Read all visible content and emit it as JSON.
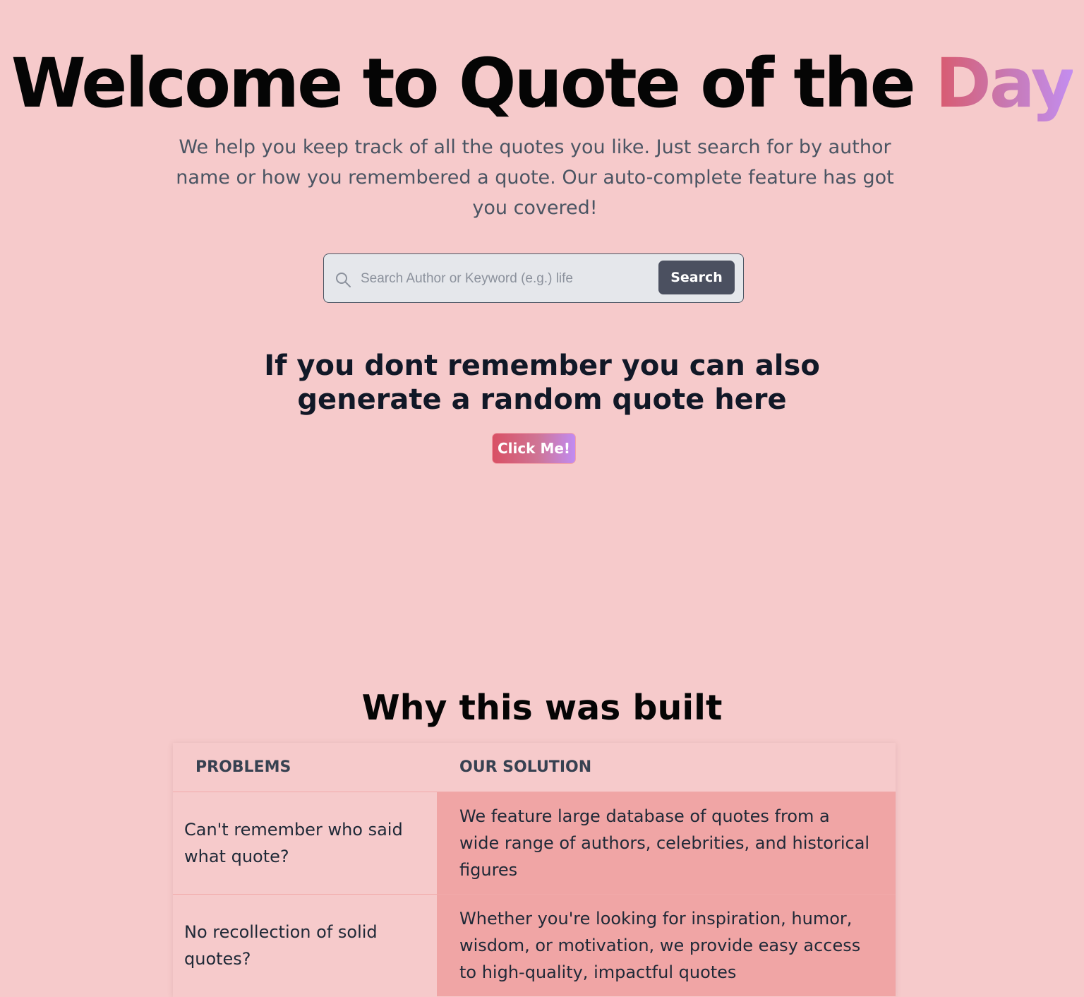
{
  "hero": {
    "title_main": "Welcome to Quote of the",
    "title_accent": "Day",
    "description": "We help you keep track of all the quotes you like. Just search for by author name or how you remembered a quote. Our auto-complete feature has got you covered!"
  },
  "search": {
    "icon": "search-icon",
    "placeholder": "Search Author or Keyword (e.g.) life",
    "value": "",
    "button_label": "Search"
  },
  "random": {
    "heading": "If you dont remember you can also generate a random quote here",
    "button_label": "Click Me!"
  },
  "why": {
    "title": "Why this was built",
    "headers": {
      "problems": "PROBLEMS",
      "solution": "OUR SOLUTION"
    },
    "rows": [
      {
        "problem": "Can't remember who said what quote?",
        "solution": "We feature large database of quotes from a wide range of authors, celebrities, and historical figures"
      },
      {
        "problem": "No recollection of solid quotes?",
        "solution": "Whether you're looking for inspiration, humor, wisdom, or motivation, we provide easy access to high-quality, impactful quotes"
      }
    ]
  },
  "colors": {
    "page_background": "#f6cacb",
    "accent_gradient_start": "#d95a6d",
    "accent_gradient_end": "#c38df0",
    "search_button": "#4b5060",
    "solution_cell": "#f0a5a5"
  }
}
